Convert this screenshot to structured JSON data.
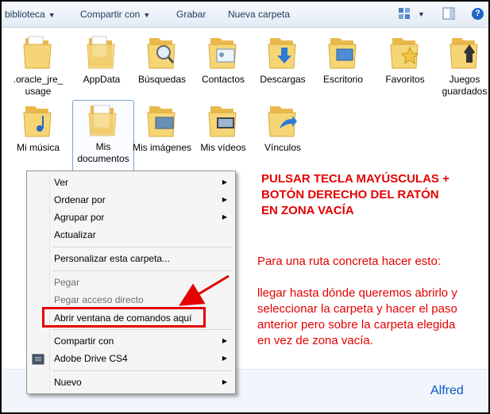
{
  "toolbar": {
    "location_label": "biblioteca",
    "share_label": "Compartir con",
    "burn_label": "Grabar",
    "new_folder_label": "Nueva carpeta"
  },
  "folders": [
    {
      "label": ".oracle_jre_ usage",
      "icon": "plain-folder-icon"
    },
    {
      "label": "AppData",
      "icon": "plain-folder-icon"
    },
    {
      "label": "Búsquedas",
      "icon": "search-folder-icon"
    },
    {
      "label": "Contactos",
      "icon": "contacts-folder-icon"
    },
    {
      "label": "Descargas",
      "icon": "downloads-folder-icon"
    },
    {
      "label": "Escritorio",
      "icon": "desktop-folder-icon"
    },
    {
      "label": "Favoritos",
      "icon": "favorites-folder-icon"
    },
    {
      "label": "Juegos guardados",
      "icon": "games-folder-icon"
    },
    {
      "label": "Mi música",
      "icon": "music-folder-icon"
    },
    {
      "label": "Mis documentos",
      "icon": "documents-folder-icon"
    },
    {
      "label": "Mis imágenes",
      "icon": "pictures-folder-icon"
    },
    {
      "label": "Mis vídeos",
      "icon": "videos-folder-icon"
    },
    {
      "label": "Vínculos",
      "icon": "links-folder-icon"
    }
  ],
  "context_menu": {
    "view": "Ver",
    "sort_by": "Ordenar por",
    "group_by": "Agrupar por",
    "refresh": "Actualizar",
    "customize": "Personalizar esta carpeta...",
    "paste": "Pegar",
    "paste_shortcut": "Pegar acceso directo",
    "open_cmd": "Abrir ventana de comandos aquí",
    "share_with": "Compartir con",
    "adobe_drive": "Adobe Drive CS4",
    "new": "Nuevo"
  },
  "annotations": {
    "instruction_line1": "PULSAR TECLA MAYÚSCULAS +",
    "instruction_line2": "BOTÓN DERECHO DEL RATÓN",
    "instruction_line3": "EN ZONA VACÍA",
    "sub_line1": "Para una ruta concreta hacer esto:",
    "sub_line2": "llegar hasta dónde queremos abrirlo y",
    "sub_line3": "seleccionar la carpeta y hacer el paso",
    "sub_line4": "anterior pero sobre la carpeta elegida",
    "sub_line5": "en vez de zona vacía.",
    "author": "Alfred"
  },
  "colors": {
    "accent_red": "#e30000",
    "author_blue": "#0b55c4",
    "folder_yellow": "#f5d576"
  }
}
